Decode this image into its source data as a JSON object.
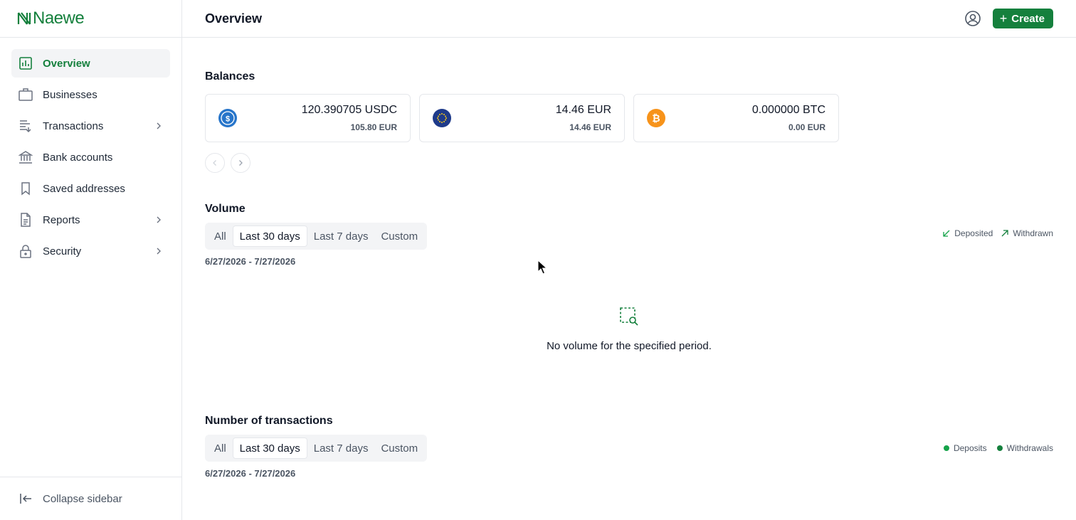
{
  "app": {
    "name": "Naewe"
  },
  "sidebar": {
    "items": [
      {
        "label": "Overview",
        "icon": "bar-chart-icon",
        "active": true
      },
      {
        "label": "Businesses",
        "icon": "briefcase-icon"
      },
      {
        "label": "Transactions",
        "icon": "transactions-icon",
        "expandable": true
      },
      {
        "label": "Bank accounts",
        "icon": "bank-icon"
      },
      {
        "label": "Saved addresses",
        "icon": "bookmark-icon"
      },
      {
        "label": "Reports",
        "icon": "document-icon",
        "expandable": true
      },
      {
        "label": "Security",
        "icon": "lock-icon",
        "expandable": true
      }
    ],
    "collapse_label": "Collapse sidebar"
  },
  "header": {
    "title": "Overview",
    "create_label": "Create"
  },
  "balances": {
    "title": "Balances",
    "cards": [
      {
        "amount": "120.390705 USDC",
        "fiat": "105.80 EUR",
        "icon": "usdc-icon",
        "color": "#2775ca"
      },
      {
        "amount": "14.46 EUR",
        "fiat": "14.46 EUR",
        "icon": "euro-icon",
        "color": "#1e40af"
      },
      {
        "amount": "0.000000 BTC",
        "fiat": "0.00 EUR",
        "icon": "bitcoin-icon",
        "color": "#f7931a"
      }
    ]
  },
  "volume": {
    "title": "Volume",
    "tabs": [
      "All",
      "Last 30 days",
      "Last 7 days",
      "Custom"
    ],
    "active_tab": "Last 30 days",
    "date_range": "6/27/2026 - 7/27/2026",
    "legend": [
      "Deposited",
      "Withdrawn"
    ],
    "empty_message": "No volume for the specified period."
  },
  "transactions": {
    "title": "Number of transactions",
    "tabs": [
      "All",
      "Last 30 days",
      "Last 7 days",
      "Custom"
    ],
    "active_tab": "Last 30 days",
    "date_range": "6/27/2026 - 7/27/2026",
    "legend": [
      "Deposits",
      "Withdrawals"
    ]
  },
  "colors": {
    "brand": "#15803d",
    "deposit_dot": "#16a34a",
    "withdraw_dot": "#15803d"
  }
}
